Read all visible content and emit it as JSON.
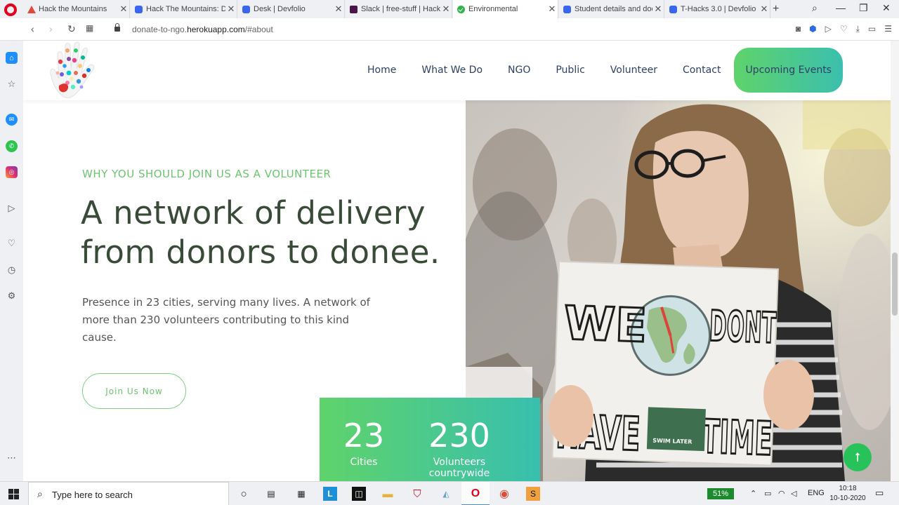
{
  "browser": {
    "tabs": [
      {
        "label": "Hack the Mountains",
        "favicon": "triangle-icon",
        "active": false
      },
      {
        "label": "Hack The Mountains: De",
        "favicon": "devfolio-icon",
        "active": false
      },
      {
        "label": "Desk | Devfolio",
        "favicon": "devfolio-icon",
        "active": false
      },
      {
        "label": "Slack | free-stuff | Hack T",
        "favicon": "slack-icon",
        "active": false
      },
      {
        "label": "Environmental",
        "favicon": "check-icon",
        "active": true
      },
      {
        "label": "Student details and doc",
        "favicon": "devfolio-icon",
        "active": false
      },
      {
        "label": "T-Hacks 3.0 | Devfolio",
        "favicon": "devfolio-icon",
        "active": false
      }
    ],
    "address": {
      "prefix": "donate-to-ngo.",
      "domain": "herokuapp.com",
      "path": "/#about"
    }
  },
  "site": {
    "nav": {
      "items": [
        "Home",
        "What We Do",
        "NGO",
        "Public",
        "Volunteer",
        "Contact"
      ],
      "cta": "Upcoming Events"
    },
    "about": {
      "eyebrow": "WHY YOU SHOULD JOIN US AS A VOLUNTEER",
      "headline_line1": "A network of delivery",
      "headline_line2": "from donors to donee.",
      "lead": "Presence in 23 cities, serving many lives. A network of more than 230 volunteers contributing to this kind cause.",
      "button": "Join Us Now"
    },
    "photo_sign": {
      "line1_left": "WE",
      "line1_right": "DONT",
      "line2_left": "HAVE",
      "line2_right": "TIME",
      "sticker": "SWIM LATER"
    },
    "stats": [
      {
        "value": "23",
        "label": "Cities"
      },
      {
        "value": "230",
        "label": "Volunteers countrywide"
      }
    ],
    "back_to_top_icon": "arrow-up-icon"
  },
  "taskbar": {
    "search_placeholder": "Type here to search",
    "battery": "51%",
    "language": "ENG",
    "time": "10:18",
    "date": "10-10-2020"
  },
  "colors": {
    "accent_green": "#6cc46f",
    "gradient_start": "#5fd36b",
    "gradient_end": "#38bfae",
    "nav_text": "#2f4066",
    "headline": "#3a4a39"
  }
}
